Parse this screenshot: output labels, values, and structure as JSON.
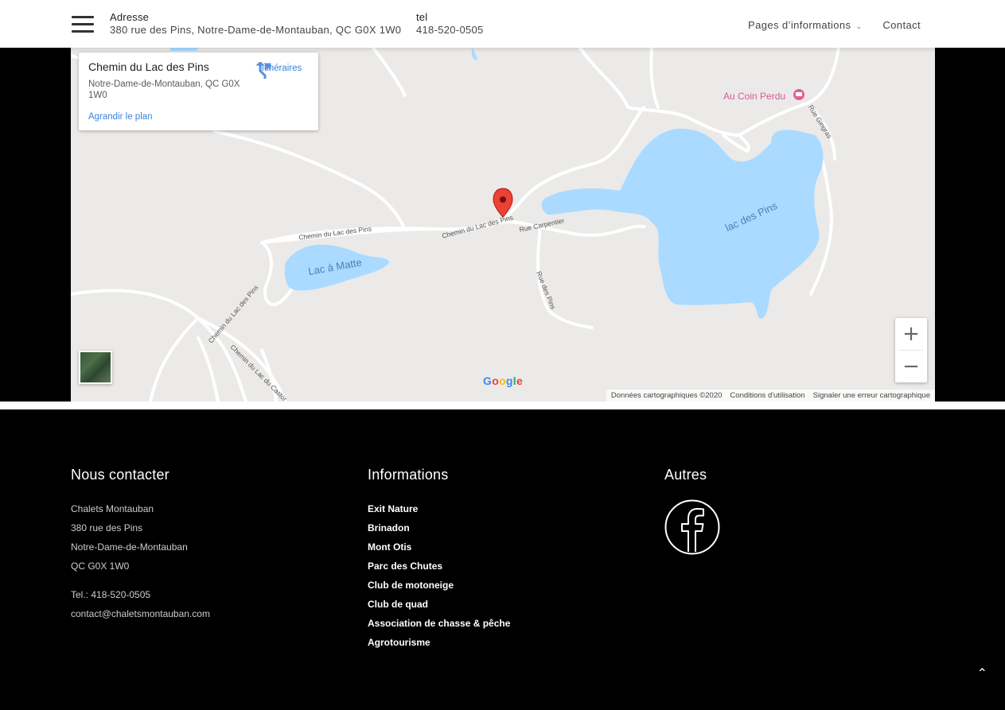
{
  "header": {
    "address_label": "Adresse",
    "address_value": "380 rue des Pins, Notre-Dame-de-Montauban, QC G0X 1W0",
    "tel_label": "tel",
    "tel_value": "418-520-0505",
    "nav": {
      "info_pages": "Pages d’informations",
      "contact": "Contact"
    }
  },
  "map": {
    "card": {
      "title": "Chemin du Lac des Pins",
      "address": "Notre-Dame-de-Montauban, QC G0X 1W0",
      "directions": "Itinéraires",
      "enlarge": "Agrandir le plan"
    },
    "poi": "Au Coin Perdu",
    "labels": {
      "lake_matte": "Lac à Matte",
      "lake_pins": "lac des Pins",
      "road_1": "Chemin du Lac des Pins",
      "road_2": "Chemin du Lac des Pins",
      "road_3": "Chemin du Lac des Pins",
      "road_4": "Chemin du Lac du Castor",
      "road_5": "Rue Carpentier",
      "road_6": "Rue des Pins",
      "road_7": "Rue Gingras"
    },
    "zoom_in": "+",
    "zoom_out": "−",
    "google": "Google",
    "attribution": {
      "data": "Données cartographiques ©2020",
      "terms": "Conditions d'utilisation",
      "report": "Signaler une erreur cartographique"
    }
  },
  "footer": {
    "contact": {
      "heading": "Nous contacter",
      "name": "Chalets Montauban",
      "street": "380 rue des Pins",
      "city": "Notre-Dame-de-Montauban",
      "postal": "QC G0X 1W0",
      "tel": "Tel.: 418-520-0505",
      "email": "contact@chaletsmontauban.com"
    },
    "info": {
      "heading": "Informations",
      "links": [
        "Exit Nature",
        "Brinadon",
        "Mont Otis",
        "Parc des Chutes",
        "Club de motoneige",
        "Club de quad",
        "Association de chasse & pêche",
        "Agrotourisme"
      ]
    },
    "others": {
      "heading": "Autres"
    },
    "back_to_top": "⌃"
  }
}
